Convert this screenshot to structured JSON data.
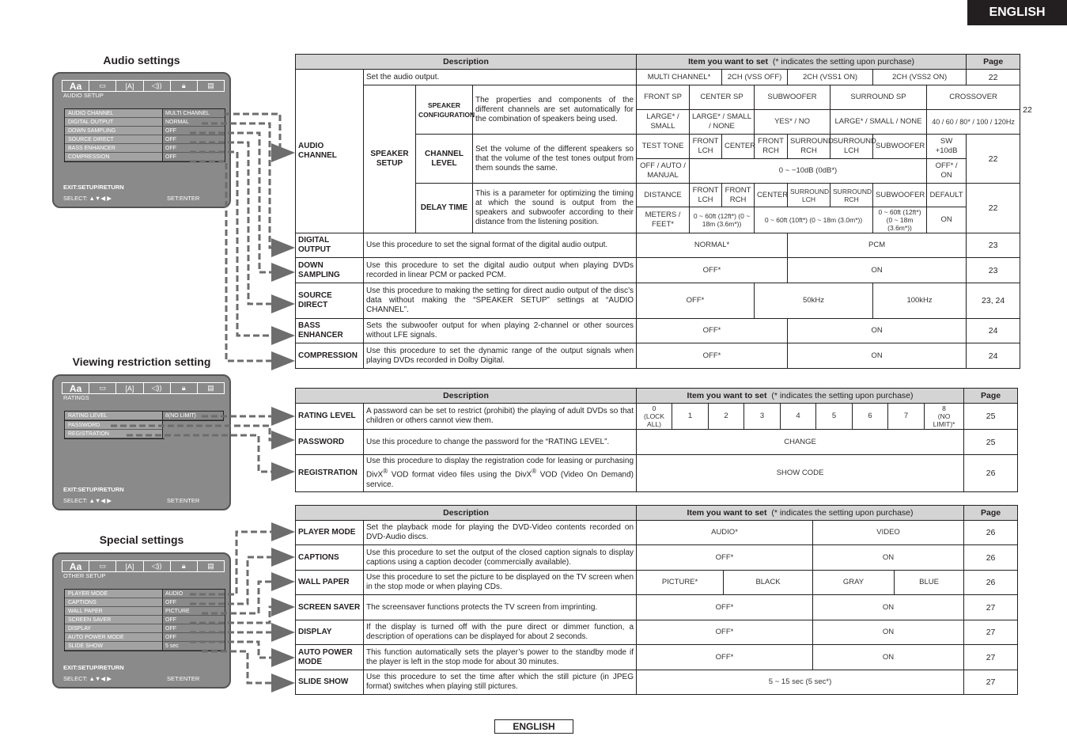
{
  "header": {
    "language_tab": "ENGLISH"
  },
  "footer": {
    "language_label": "ENGLISH"
  },
  "osd_common": {
    "tabs": [
      {
        "icon": "language-icon",
        "glyph": "Aa"
      },
      {
        "icon": "display-icon",
        "glyph": "▭"
      },
      {
        "icon": "video-icon",
        "glyph": "[A]"
      },
      {
        "icon": "speaker-icon",
        "glyph": "◁))"
      },
      {
        "icon": "lock-icon",
        "glyph": "🔒"
      },
      {
        "icon": "other-icon",
        "glyph": "▤"
      }
    ],
    "exit": "EXIT:SETUP/RETURN",
    "select": "SELECT: ▲▼◀ ▶",
    "set": "SET:ENTER"
  },
  "audio": {
    "section_title": "Audio settings",
    "osd": {
      "screen_title": "AUDIO SETUP",
      "menu": [
        {
          "label": "AUDIO CHANNEL",
          "value": "MULTI CHANNEL"
        },
        {
          "label": "DIGITAL OUTPUT",
          "value": "NORMAL"
        },
        {
          "label": "DOWN SAMPLING",
          "value": "OFF"
        },
        {
          "label": "SOURCE DIRECT",
          "value": "OFF"
        },
        {
          "label": "BASS ENHANCER",
          "value": "OFF"
        },
        {
          "label": "COMPRESSION",
          "value": "OFF"
        }
      ]
    },
    "table": {
      "headers": {
        "description": "Description",
        "item": "Item you want to set",
        "item_note": "(* indicates the setting upon purchase)",
        "page": "Page"
      },
      "audio_channel": {
        "label": "AUDIO CHANNEL",
        "desc": "Set the audio output.",
        "options": [
          "MULTI CHANNEL*",
          "2CH (VSS OFF)",
          "2CH (VSS1 ON)",
          "2CH (VSS2 ON)"
        ],
        "page": "22",
        "speaker_setup_label": "SPEAKER SETUP",
        "speaker_config": {
          "label": "SPEAKER CONFIGURATION",
          "desc": "The properties and components of the different channels are set automatically for the combination of speakers being used.",
          "items": [
            "FRONT SP",
            "CENTER SP",
            "SUBWOOFER",
            "SURROUND SP",
            "CROSSOVER"
          ],
          "values": [
            "LARGE* / SMALL",
            "LARGE* / SMALL / NONE",
            "YES* / NO",
            "LARGE* / SMALL / NONE",
            "40 / 60 / 80* / 100 / 120Hz"
          ],
          "page": "22"
        },
        "channel_level": {
          "label": "CHANNEL LEVEL",
          "desc": "Set the volume of the different speakers so that the volume of the test tones output from them sounds the same.",
          "items": [
            "TEST TONE",
            "FRONT LCH",
            "CENTER",
            "FRONT RCH",
            "SURROUND RCH",
            "SURROUND LCH",
            "SUBWOOFER",
            "SW +10dB"
          ],
          "values": [
            "OFF / AUTO / MANUAL",
            "0 ~ −10dB (0dB*)",
            "OFF* / ON"
          ],
          "page": "22"
        },
        "delay_time": {
          "label": "DELAY TIME",
          "desc": "This is a parameter for optimizing the timing at which the sound is output from the speakers and subwoofer according to their distance from the listening position.",
          "items": [
            "DISTANCE",
            "FRONT LCH",
            "FRONT RCH",
            "CENTER",
            "SURROUND LCH",
            "SURROUND RCH",
            "SUBWOOFER",
            "DEFAULT"
          ],
          "values": [
            "METERS / FEET*",
            "0 ~ 60ft (12ft*) (0 ~ 18m (3.6m*))",
            "0 ~ 60ft (10ft*) (0 ~ 18m (3.0m*))",
            "0 ~ 60ft (12ft*) (0 ~ 18m (3.6m*))",
            "ON"
          ],
          "page": "22"
        }
      },
      "rows": [
        {
          "label": "DIGITAL OUTPUT",
          "desc": "Use this procedure to set the signal format of the digital audio output.",
          "options": [
            "NORMAL*",
            "PCM"
          ],
          "page": "23"
        },
        {
          "label": "DOWN SAMPLING",
          "desc": "Use this procedure to set the digital audio output when playing DVDs recorded in linear PCM or packed PCM.",
          "options": [
            "OFF*",
            "ON"
          ],
          "page": "23"
        },
        {
          "label": "SOURCE DIRECT",
          "desc": "Use this procedure to making the setting for direct audio output of the disc’s data without making the “SPEAKER SETUP” settings at “AUDIO CHANNEL”.",
          "options": [
            "OFF*",
            "50kHz",
            "100kHz"
          ],
          "page": "23, 24"
        },
        {
          "label": "BASS ENHANCER",
          "desc": "Sets the subwoofer output for when playing 2-channel or other sources without LFE signals.",
          "options": [
            "OFF*",
            "ON"
          ],
          "page": "24"
        },
        {
          "label": "COMPRESSION",
          "desc": "Use this procedure to set the dynamic range of the output signals when playing DVDs recorded in Dolby Digital.",
          "options": [
            "OFF*",
            "ON"
          ],
          "page": "24"
        }
      ]
    }
  },
  "ratings": {
    "section_title": "Viewing restriction setting",
    "osd": {
      "screen_title": "RATINGS",
      "menu": [
        {
          "label": "RATING LEVEL",
          "value": "8(NO LIMIT)"
        },
        {
          "label": "PASSWORD",
          "value": ""
        },
        {
          "label": "REGISTRATION",
          "value": ""
        }
      ]
    },
    "table": {
      "headers": {
        "description": "Description",
        "item": "Item you want to set",
        "item_note": "(* indicates the setting upon purchase)",
        "page": "Page"
      },
      "rating_level": {
        "label": "RATING LEVEL",
        "desc": "A password can be set to restrict (prohibit) the playing of adult DVDs so that children or others cannot view them.",
        "levels": [
          {
            "num": "0",
            "note": "(LOCK ALL)"
          },
          {
            "num": "1",
            "note": ""
          },
          {
            "num": "2",
            "note": ""
          },
          {
            "num": "3",
            "note": ""
          },
          {
            "num": "4",
            "note": ""
          },
          {
            "num": "5",
            "note": ""
          },
          {
            "num": "6",
            "note": ""
          },
          {
            "num": "7",
            "note": ""
          },
          {
            "num": "8",
            "note": "(NO LIMIT)*"
          }
        ],
        "page": "25"
      },
      "password": {
        "label": "PASSWORD",
        "desc": "Use this procedure to change the password for the “RATING LEVEL”.",
        "option": "CHANGE",
        "page": "25"
      },
      "registration": {
        "label": "REGISTRATION",
        "desc_a": "Use this procedure to display the registration code for leasing or purchasing DivX",
        "desc_b": " VOD format video files using the DivX",
        "desc_c": " VOD (Video On Demand) service.",
        "reg_mark": "®",
        "option": "SHOW CODE",
        "page": "26"
      }
    }
  },
  "special": {
    "section_title": "Special settings",
    "osd": {
      "screen_title": "OTHER SETUP",
      "menu": [
        {
          "label": "PLAYER MODE",
          "value": "AUDIO"
        },
        {
          "label": "CAPTIONS",
          "value": "OFF"
        },
        {
          "label": "WALL PAPER",
          "value": "PICTURE"
        },
        {
          "label": "SCREEN SAVER",
          "value": "OFF"
        },
        {
          "label": "DISPLAY",
          "value": "OFF"
        },
        {
          "label": "AUTO POWER MODE",
          "value": "OFF"
        },
        {
          "label": "SLIDE SHOW",
          "value": "5 sec"
        }
      ]
    },
    "table": {
      "headers": {
        "description": "Description",
        "item": "Item you want to set",
        "item_note": "(* indicates the setting upon purchase)",
        "page": "Page"
      },
      "rows": [
        {
          "label": "PLAYER MODE",
          "desc": "Set the playback mode for playing the DVD-Video contents recorded on DVD-Audio discs.",
          "options": [
            "AUDIO*",
            "VIDEO"
          ],
          "page": "26"
        },
        {
          "label": "CAPTIONS",
          "desc": "Use this procedure to set the output of the closed caption signals to display captions using a caption decoder (commercially available).",
          "options": [
            "OFF*",
            "ON"
          ],
          "page": "26"
        },
        {
          "label": "WALL PAPER",
          "desc": "Use this procedure to set the picture to be displayed on the TV screen when in the stop mode or when playing CDs.",
          "options": [
            "PICTURE*",
            "BLACK",
            "GRAY",
            "BLUE"
          ],
          "page": "26"
        },
        {
          "label": "SCREEN SAVER",
          "desc": "The screensaver functions protects the TV screen from imprinting.",
          "options": [
            "OFF*",
            "ON"
          ],
          "page": "27"
        },
        {
          "label": "DISPLAY",
          "desc": "If the display is turned off with the pure direct or dimmer function, a description of operations can be displayed for about 2 seconds.",
          "options": [
            "OFF*",
            "ON"
          ],
          "page": "27"
        },
        {
          "label": "AUTO POWER MODE",
          "desc": "This function automatically sets the player’s power to the standby mode if the player is left in the stop mode for about 30 minutes.",
          "options": [
            "OFF*",
            "ON"
          ],
          "page": "27"
        },
        {
          "label": "SLIDE SHOW",
          "desc": "Use this procedure to set the time after which the still picture (in JPEG format) switches when playing still pictures.",
          "options": [
            "5 ~ 15 sec (5 sec*)"
          ],
          "page": "27"
        }
      ]
    }
  }
}
